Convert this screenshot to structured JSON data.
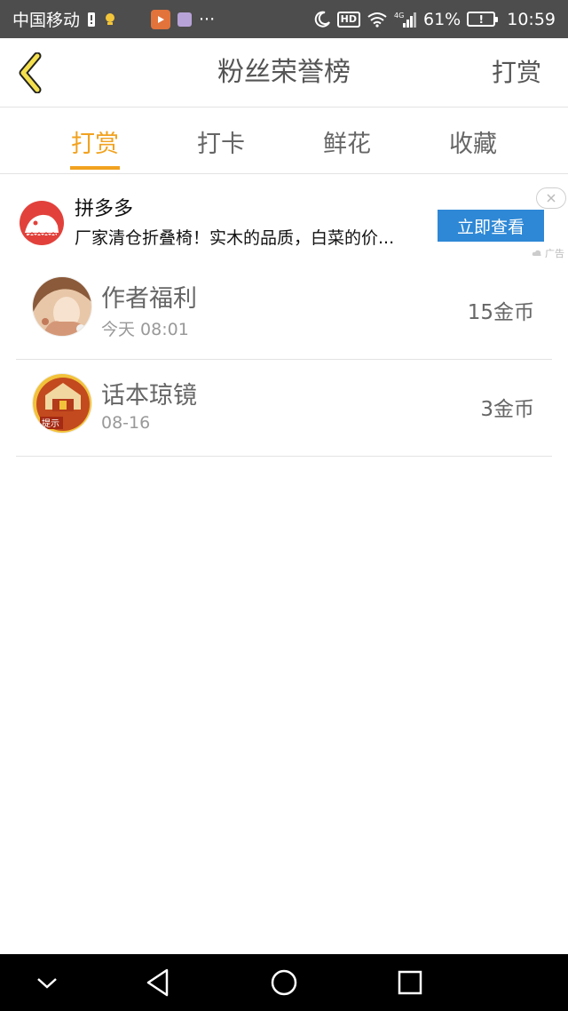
{
  "status_bar": {
    "carrier": "中国移动",
    "more": "···",
    "network": "4G",
    "battery_percent": "61%",
    "battery_glyph": "!",
    "time": "10:59",
    "hd_label": "HD"
  },
  "header": {
    "title": "粉丝荣誉榜",
    "right_action": "打赏"
  },
  "tabs": [
    {
      "label": "打赏",
      "active": true
    },
    {
      "label": "打卡",
      "active": false
    },
    {
      "label": "鲜花",
      "active": false
    },
    {
      "label": "收藏",
      "active": false
    }
  ],
  "ad": {
    "advertiser": "拼多多",
    "description": "厂家清仓折叠椅！实木的品质，白菜的价...",
    "cta": "立即查看",
    "mark": "广告"
  },
  "list": [
    {
      "name": "作者福利",
      "time": "今天 08:01",
      "amount": "15金币",
      "avatar_tag": ""
    },
    {
      "name": "话本琼镜",
      "time": "08-16",
      "amount": "3金币",
      "avatar_tag": "提示"
    }
  ],
  "colors": {
    "accent": "#f1a21f",
    "ad_button": "#2e88d6",
    "ad_logo": "#e2413b",
    "status_bar": "#4d4d4d"
  }
}
